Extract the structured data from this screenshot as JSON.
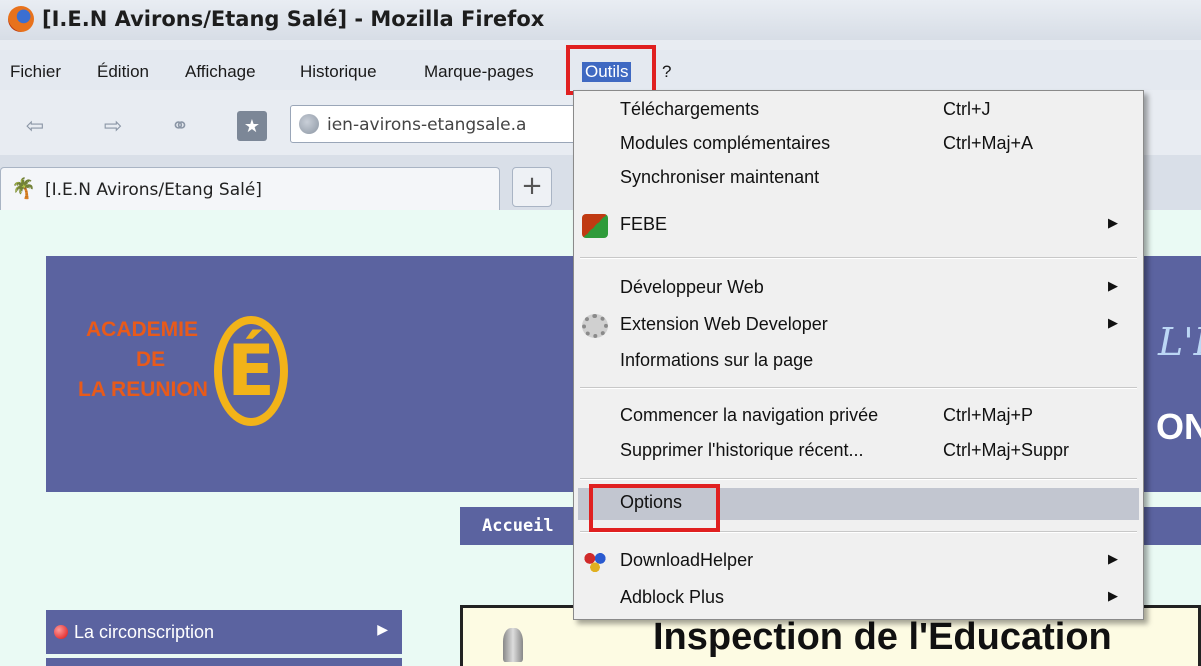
{
  "window": {
    "title": "[I.E.N Avirons/Etang Salé] - Mozilla Firefox"
  },
  "menubar": {
    "items": [
      {
        "label": "Fichier"
      },
      {
        "label": "Édition"
      },
      {
        "label": "Affichage"
      },
      {
        "label": "Historique"
      },
      {
        "label": "Marque-pages"
      },
      {
        "label": "Outils"
      },
      {
        "label": "?"
      }
    ]
  },
  "navbar": {
    "url": "ien-avirons-etangsale.a"
  },
  "tabs": {
    "active_label": "[I.E.N Avirons/Etang Salé]",
    "new_tab": "+"
  },
  "outils_menu": {
    "items": [
      {
        "label": "Téléchargements",
        "shortcut": "Ctrl+J"
      },
      {
        "label": "Modules complémentaires",
        "shortcut": "Ctrl+Maj+A"
      },
      {
        "label": "Synchroniser maintenant",
        "shortcut": ""
      },
      {
        "label": "FEBE",
        "shortcut": ""
      },
      {
        "label": "Développeur Web",
        "shortcut": ""
      },
      {
        "label": "Extension Web Developer",
        "shortcut": ""
      },
      {
        "label": "Informations sur la page",
        "shortcut": ""
      },
      {
        "label": "Commencer la navigation privée",
        "shortcut": "Ctrl+Maj+P"
      },
      {
        "label": "Supprimer l'historique récent...",
        "shortcut": "Ctrl+Maj+Suppr"
      },
      {
        "label": "Options",
        "shortcut": ""
      },
      {
        "label": "DownloadHelper",
        "shortcut": ""
      },
      {
        "label": "Adblock Plus",
        "shortcut": ""
      }
    ],
    "submenu_arrow": "▶"
  },
  "page": {
    "logo_lines": [
      "ACADEMIE",
      "DE",
      "LA REUNION"
    ],
    "logo_letter": "É",
    "banner_fragment_1": "L'E",
    "banner_fragment_2": "ON",
    "accueil": "Accueil",
    "sidebar_item": "La circonscription",
    "content_title": "Inspection de l'Education"
  },
  "colors": {
    "menu_highlight": "#c2c6d0",
    "annotation_red": "#e02020",
    "banner": "#5b63a0",
    "page_bg": "#eafaf4"
  }
}
